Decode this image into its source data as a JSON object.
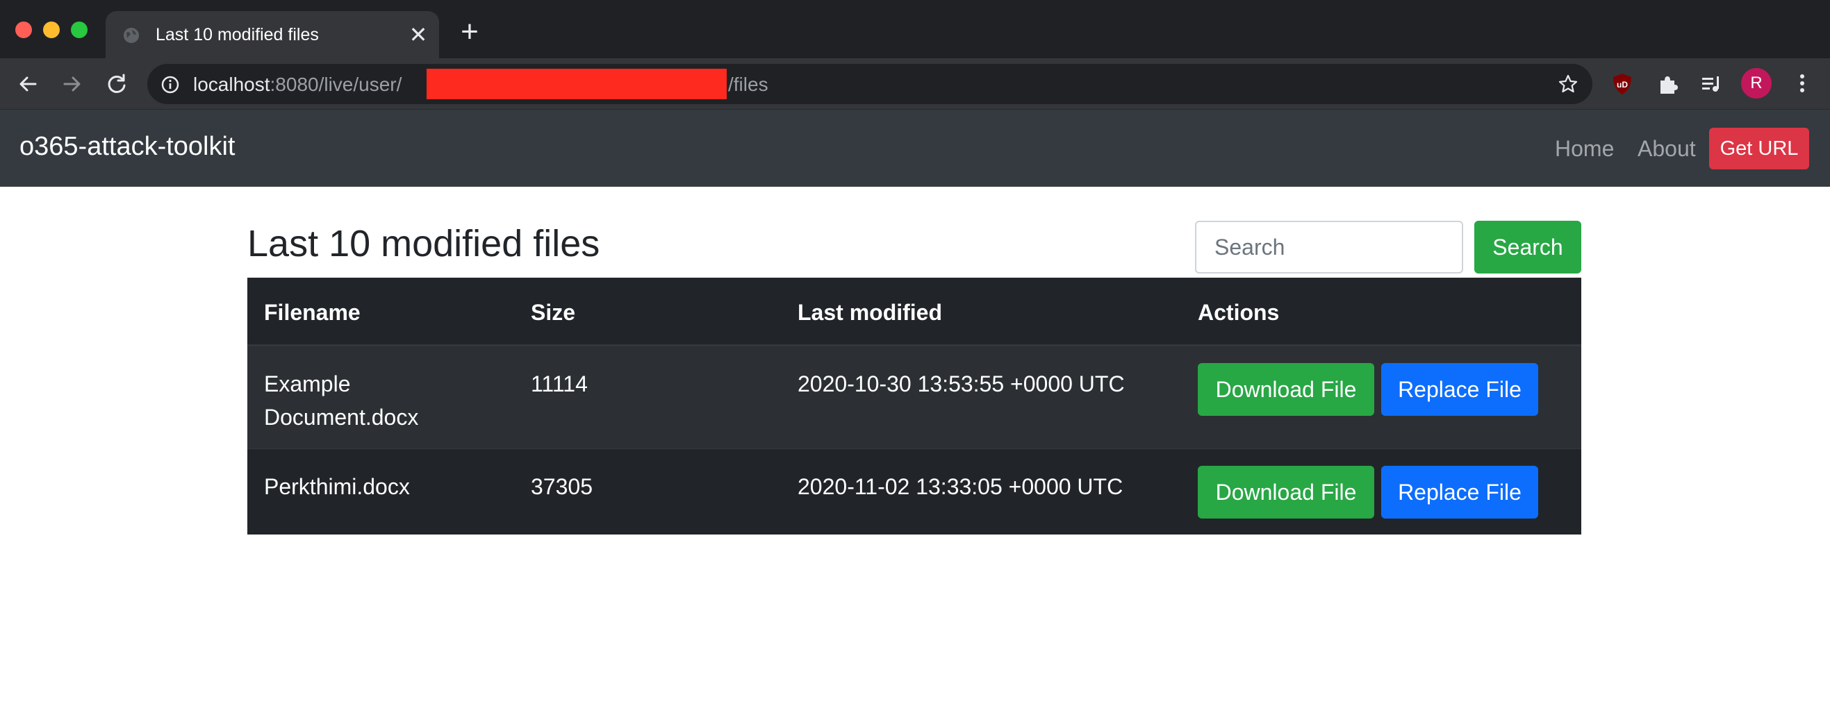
{
  "browser": {
    "tab_title": "Last 10 modified files",
    "tab_close": "✕",
    "new_tab": "+",
    "url_host": "localhost",
    "url_path_prefix": ":8080/live/user/",
    "url_path_suffix": "/files",
    "avatar_initial": "R"
  },
  "navbar": {
    "brand": "o365-attack-toolkit",
    "links": [
      "Home",
      "About"
    ],
    "get_url_label": "Get URL"
  },
  "main": {
    "title": "Last 10 modified files",
    "search_placeholder": "Search",
    "search_button": "Search",
    "table": {
      "headers": [
        "Filename",
        "Size",
        "Last modified",
        "Actions"
      ],
      "rows": [
        {
          "filename": "Example Document.docx",
          "size": "11114",
          "modified": "2020-10-30 13:53:55 +0000 UTC",
          "download_label": "Download File",
          "replace_label": "Replace File"
        },
        {
          "filename": "Perkthimi.docx",
          "size": "37305",
          "modified": "2020-11-02 13:33:05 +0000 UTC",
          "download_label": "Download File",
          "replace_label": "Replace File"
        }
      ]
    }
  },
  "colors": {
    "navbar_bg": "#343a40",
    "danger": "#dc3545",
    "success": "#28a745",
    "primary": "#0d6efd",
    "table_dark": "#212529"
  }
}
